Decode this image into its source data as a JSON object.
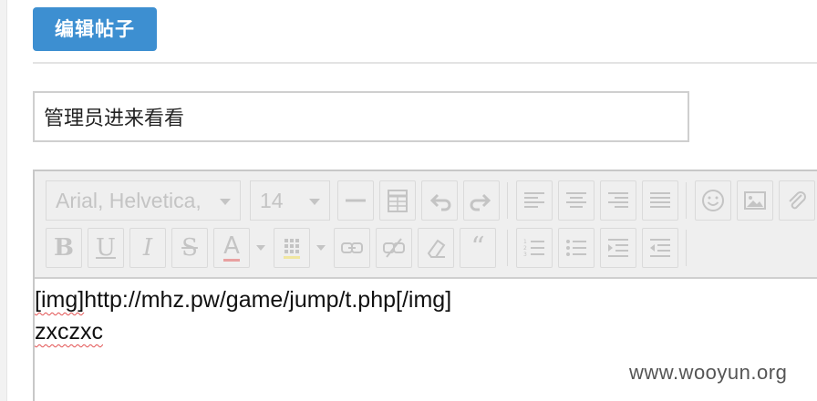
{
  "page_title": "编辑帖子",
  "subject": {
    "value": "管理员进来看看"
  },
  "toolbar": {
    "font_family": "Arial, Helvetica,",
    "font_size": "14",
    "row1": [
      {
        "name": "horizontal-rule-icon"
      },
      {
        "name": "table-icon"
      },
      {
        "name": "undo-icon"
      },
      {
        "name": "redo-icon"
      },
      {
        "name": "align-left-icon"
      },
      {
        "name": "align-center-icon"
      },
      {
        "name": "align-right-icon"
      },
      {
        "name": "align-justify-icon"
      },
      {
        "name": "emoticon-icon"
      },
      {
        "name": "image-icon"
      },
      {
        "name": "attachment-icon"
      }
    ],
    "bold_glyph": "B",
    "underline_glyph": "U",
    "italic_glyph": "I",
    "strike_glyph": "S",
    "fontcolor_glyph": "A",
    "quote_glyph": "“"
  },
  "content": {
    "line1_prefix": "[img]",
    "line1_rest": "http://mhz.pw/game/jump/t.php[/img]",
    "line2": "zxczxc"
  },
  "watermark": "www.wooyun.org",
  "colors": {
    "title_bg": "#3d8fd1",
    "toolbar_bg": "#efefef",
    "icon": "#c4c4c4",
    "spell": "#e25050"
  }
}
